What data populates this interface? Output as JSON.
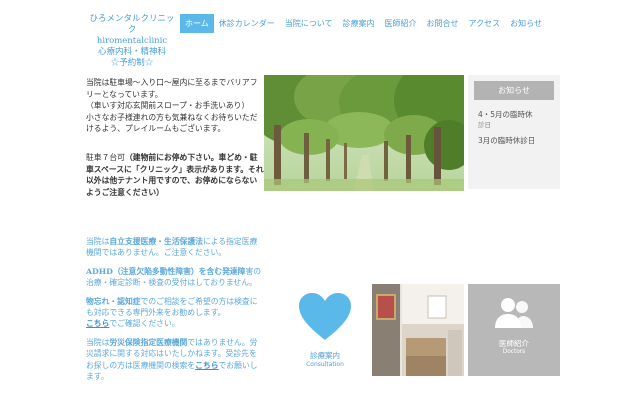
{
  "logo": {
    "line1": "ひろメンタルクリニック",
    "line2": "hiromentalclinic",
    "line3": "心療内科・精神科",
    "line4": "☆予約制☆"
  },
  "nav": [
    {
      "label": "ホーム",
      "active": true
    },
    {
      "label": "休診カレンダー"
    },
    {
      "label": "当院について"
    },
    {
      "label": "診療案内"
    },
    {
      "label": "医師紹介"
    },
    {
      "label": "お問合せ"
    },
    {
      "label": "アクセス"
    },
    {
      "label": "お知らせ"
    }
  ],
  "intro": {
    "p1": "当院は駐車場〜入り口〜屋内に至るまでバリアフリーとなっています。",
    "p2": "（車いす対応玄関前スロープ・お手洗いあり）",
    "p3": "小さなお子様連れの方も気兼ねなくお待ちいただけるよう、プレイルームもございます。"
  },
  "parking": {
    "lead": "駐車７台可",
    "bold": "（建物前にお停め下さい。車どめ・駐車スペースに「クリニック」表示があります。それ以外は他テナント用ですので、お停めにならないようご注意ください）"
  },
  "news": {
    "heading": "お知らせ",
    "items": [
      {
        "title": "4・5月の臨時休",
        "meta": "診日"
      },
      {
        "title": "3月の臨時休診日",
        "meta": ""
      }
    ]
  },
  "notices": {
    "n1_pre": "当院は",
    "n1_bold": "自立支援医療・生活保護法",
    "n1_post": "による指定医療機関ではありません。ご注意ください。",
    "n2_bold": "ADHD（注意欠陥多動性障害）を含む発達障",
    "n2_post": "害の治療・確定診断・検査の受付はしておりません。",
    "n3_bold": "物忘れ・認知症",
    "n3_post": "でのご相談をご希望の方は検査にも対応できる専門外来をお勧めします。",
    "n3_link": "こちら",
    "n3_end": "でご確認ください。",
    "n4_pre": "当院は",
    "n4_bold": "労災保険指定医療機関",
    "n4_post": "ではありません。労災請求に関する対応はいたしかねます。受診先をお探しの方は医療機関の検索を",
    "n4_link": "こちら",
    "n4_end": "でお願いします。"
  },
  "tiles": {
    "diag_label": "診療案内",
    "diag_sub": "Consultation",
    "doctor_label": "医師紹介",
    "doctor_sub": "Doctors"
  },
  "colors": {
    "accent": "#5bb9ea",
    "link": "#4a9fd8",
    "news_head": "#b3b3b3",
    "tile_gray": "#b8b8b8"
  }
}
